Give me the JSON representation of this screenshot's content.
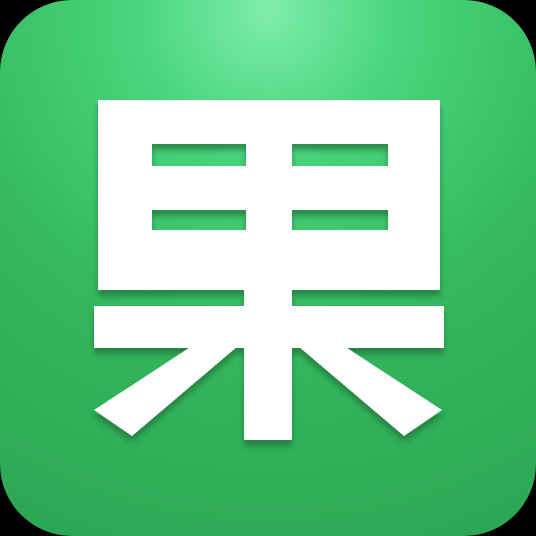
{
  "app_icon": {
    "glyph_name": "guo-character-glyph",
    "colors": {
      "background_top": "#7eedaa",
      "background_mid": "#35b85e",
      "background_bottom": "#2aa653",
      "glyph_fill": "#ffffff",
      "glyph_shadow": "#1f6a35"
    }
  }
}
